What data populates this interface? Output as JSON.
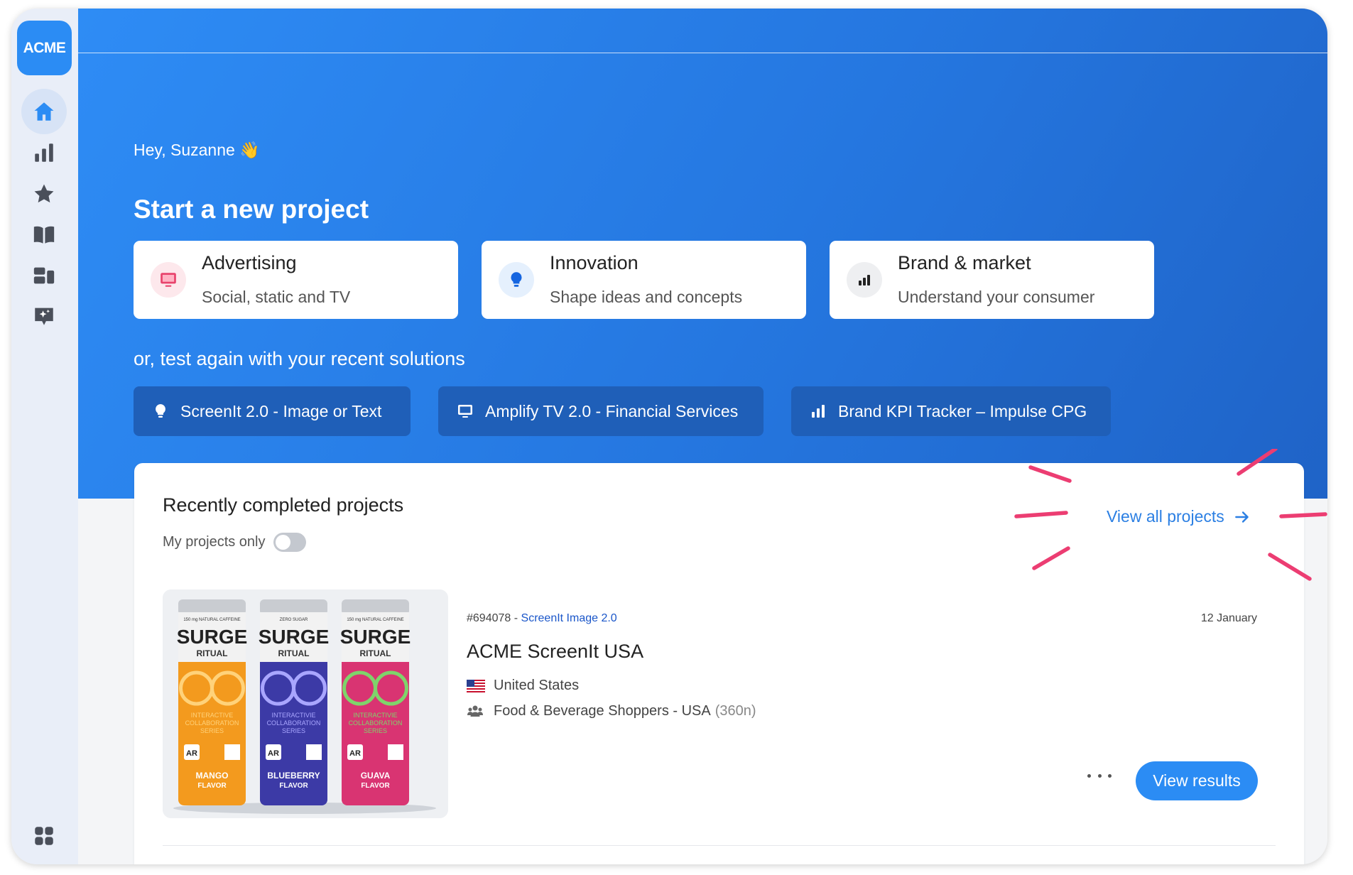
{
  "brand": {
    "logo_text": "ACME",
    "accent": "#2b8cf4"
  },
  "sidebar": {
    "items": [
      {
        "icon": "home-icon",
        "active": true
      },
      {
        "icon": "bar-chart-icon",
        "active": false
      },
      {
        "icon": "star-icon",
        "active": false
      },
      {
        "icon": "book-icon",
        "active": false
      },
      {
        "icon": "dashboard-icon",
        "active": false
      },
      {
        "icon": "sparkle-chat-icon",
        "active": false
      },
      {
        "icon": "apps-grid-icon",
        "active": false
      }
    ]
  },
  "hero": {
    "greeting": "Hey, Suzanne 👋",
    "title": "Start a new project",
    "cards": [
      {
        "title": "Advertising",
        "subtitle": "Social, static and TV",
        "icon": "monitor-icon"
      },
      {
        "title": "Innovation",
        "subtitle": "Shape ideas and concepts",
        "icon": "lightbulb-icon"
      },
      {
        "title": "Brand & market",
        "subtitle": "Understand your consumer",
        "icon": "bar-chart-icon"
      }
    ],
    "retest_label": "or, test again with your recent solutions",
    "solutions": [
      {
        "label": "ScreenIt 2.0 - Image or Text",
        "icon": "lightbulb-icon"
      },
      {
        "label": "Amplify TV 2.0 - Financial Services",
        "icon": "monitor-icon"
      },
      {
        "label": "Brand KPI Tracker – Impulse CPG",
        "icon": "bar-chart-icon"
      }
    ]
  },
  "recent": {
    "title": "Recently completed projects",
    "toggle_label": "My projects only",
    "toggle_on": false,
    "view_all": "View all projects",
    "project": {
      "id": "#694078",
      "separator": " - ",
      "solution": "ScreenIt Image 2.0",
      "date": "12 January",
      "name": "ACME ScreenIt USA",
      "country": "United States",
      "audience": "Food & Beverage Shoppers - USA",
      "sample": "(360n)",
      "results_button": "View results",
      "thumbnail": {
        "cans": [
          {
            "brand": "SURGE",
            "line": "RITUAL",
            "top": "150 mg NATURAL CAFFEINE",
            "series": "INTERACTIVE COLLABORATION SERIES",
            "flavor": "MANGO",
            "flavor_suffix": "FLAVOR",
            "badge": "AR",
            "color": "#f39a1e",
            "ring": "#ffd27a"
          },
          {
            "brand": "SURGE",
            "line": "RITUAL",
            "top": "ZERO SUGAR",
            "series": "INTERACTIVIE COLLABORATION SERIES",
            "flavor": "BLUEBERRY",
            "flavor_suffix": "FLAVOR",
            "badge": "AR",
            "color": "#3c3aa6",
            "ring": "#a9a6ff"
          },
          {
            "brand": "SURGE",
            "line": "RITUAL",
            "top": "150 mg NATURAL CAFFEINE",
            "series": "INTERACTIVIE COLLABORATION SERIES",
            "flavor": "GUAVA",
            "flavor_suffix": "FLAVOR",
            "badge": "AR",
            "color": "#d93472",
            "ring": "#7fd46b"
          }
        ]
      }
    }
  }
}
